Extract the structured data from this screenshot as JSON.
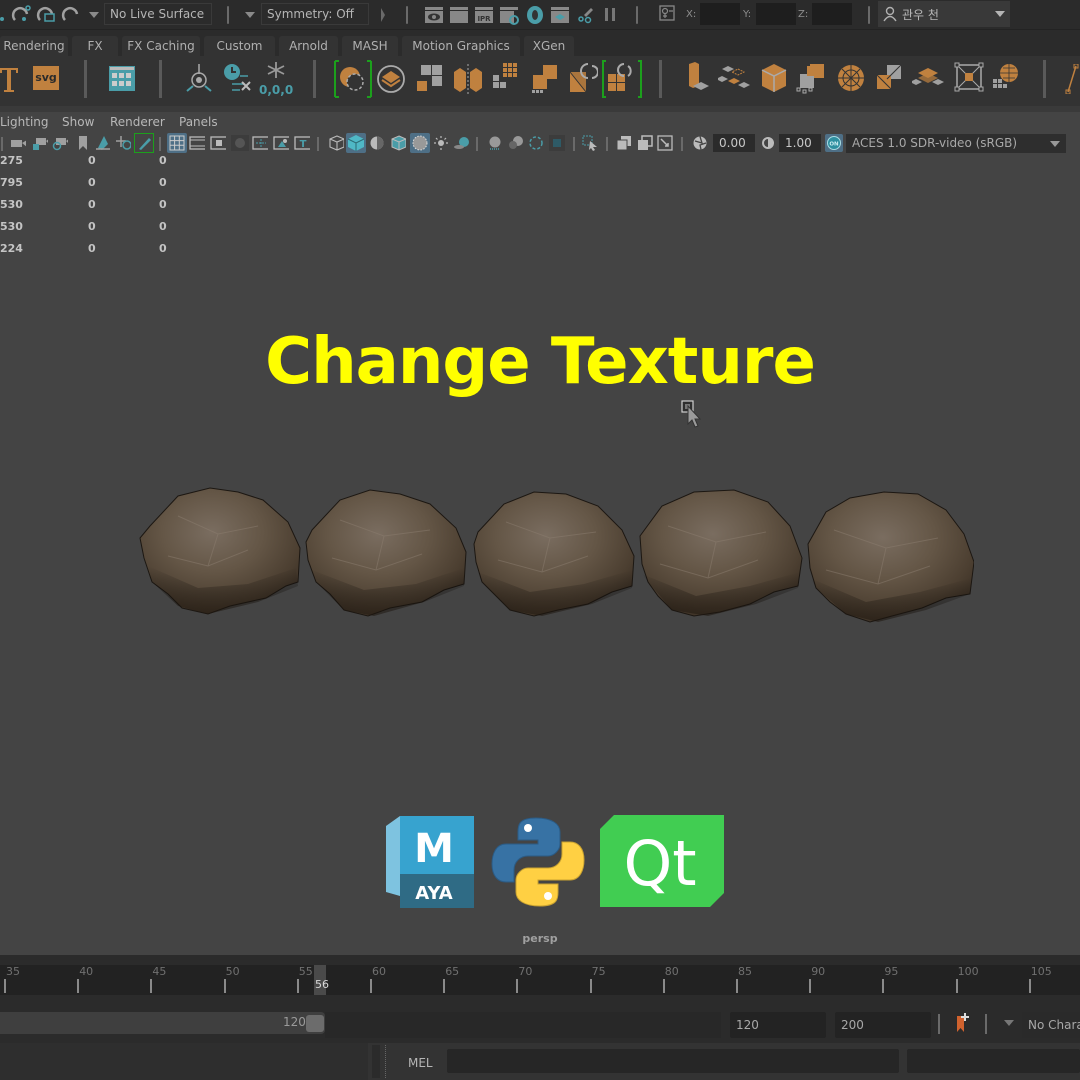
{
  "status_line": {
    "live_surface": "No Live Surface",
    "symmetry": "Symmetry: Off",
    "coords": {
      "x_label": "X:",
      "y_label": "Y:",
      "z_label": "Z:",
      "x_value": "",
      "y_value": "",
      "z_value": ""
    },
    "user_name": "관우 천",
    "icons": [
      "snap-to-curve-icon",
      "snap-to-point-icon",
      "snap-to-view-plane-icon",
      "make-live-icon",
      "render-view-icon",
      "render-current-frame-icon",
      "ipr-render-icon",
      "render-settings-icon",
      "hypershade-icon",
      "render-setup-icon",
      "light-editor-icon",
      "pause-render-icon",
      "input-line-mode-icon"
    ]
  },
  "shelf_tabs": [
    {
      "label": "Rendering"
    },
    {
      "label": "FX"
    },
    {
      "label": "FX Caching"
    },
    {
      "label": "Custom"
    },
    {
      "label": "Arnold"
    },
    {
      "label": "MASH"
    },
    {
      "label": "Motion Graphics"
    },
    {
      "label": "XGen"
    }
  ],
  "shelf": {
    "snow_label": "0,0,0",
    "svg_label": "svg",
    "icons": [
      "type-tool-icon",
      "svg-tool-icon",
      "channel-grid-icon",
      "motion-trail-icon",
      "bake-clock-icon",
      "freeze-transform-icon",
      "uv-unfold-icon",
      "layout-uv-icon",
      "uv-tile-icon",
      "uv-split-icon",
      "uv-grid-icon",
      "uv-orient-icon",
      "uv-rotate-icon",
      "uv-rotate-selected-icon",
      "planar-map-icon",
      "uv-cut-icon",
      "cube-map-icon",
      "uv-stitch-icon",
      "sphere-map-icon",
      "uv-flip-icon",
      "uv-layer-icon",
      "uv-bounding-icon",
      "uv-sphere-grid-icon"
    ]
  },
  "panel_menu": [
    {
      "label": "Lighting"
    },
    {
      "label": "Show"
    },
    {
      "label": "Renderer"
    },
    {
      "label": "Panels"
    }
  ],
  "panel_toolbar": {
    "exposure": "0.00",
    "gamma": "1.00",
    "color_management_badge": "ON",
    "color_space": "ACES 1.0 SDR-video (sRGB)",
    "icons": [
      "select-camera-icon",
      "lock-camera-icon",
      "camera-attributes-icon",
      "bookmark-icon",
      "image-plane-icon",
      "two-d-pan-zoom-icon",
      "grease-pencil-icon",
      "grid-icon",
      "film-gate-icon",
      "resolution-gate-icon",
      "gate-mask-icon",
      "field-chart-icon",
      "safe-action-icon",
      "safe-title-icon",
      "wireframe-icon",
      "smooth-shade-icon",
      "default-material-icon",
      "wireframe-on-shaded-icon",
      "xray-icon",
      "use-all-lights-icon",
      "shadows-icon",
      "screen-space-ao-icon",
      "motion-blur-icon",
      "anti-alias-icon",
      "depth-of-field-icon",
      "isolate-select-icon",
      "xray-joints-icon",
      "xray-active-icon",
      "hud-icon",
      "exposure-icon",
      "gamma-icon",
      "color-management-icon"
    ]
  },
  "hud": {
    "rows": [
      {
        "label": "275",
        "c1": "0",
        "c2": "0"
      },
      {
        "label": "795",
        "c1": "0",
        "c2": "0"
      },
      {
        "label": "530",
        "c1": "0",
        "c2": "0"
      },
      {
        "label": "530",
        "c1": "0",
        "c2": "0"
      },
      {
        "label": "224",
        "c1": "0",
        "c2": "0"
      }
    ]
  },
  "viewport": {
    "title": "Change Texture",
    "title_color": "#ffff00",
    "camera": "persp",
    "rock_count": 5,
    "logos": [
      {
        "name": "maya-logo",
        "letter": "M",
        "word": "AYA"
      },
      {
        "name": "python-logo"
      },
      {
        "name": "qt-logo",
        "text": "Qt"
      }
    ]
  },
  "time_slider": {
    "ticks": [
      "35",
      "40",
      "45",
      "50",
      "55",
      "60",
      "65",
      "70",
      "75",
      "80",
      "85",
      "90",
      "95",
      "100",
      "105"
    ],
    "current_frame": "56"
  },
  "range_slider": {
    "range_end_label": "120",
    "end_time": "120",
    "playback_end": "200",
    "character_set": "No Chara"
  },
  "command_line": {
    "language": "MEL",
    "input_value": "",
    "result_value": ""
  }
}
